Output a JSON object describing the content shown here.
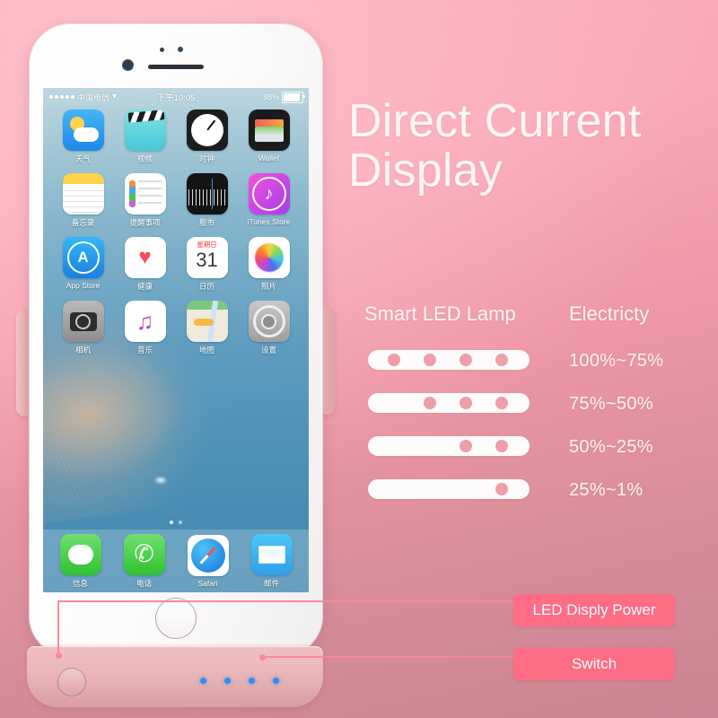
{
  "headline": {
    "line1": "Direct Current",
    "line2": "Display"
  },
  "columns": {
    "lamp": "Smart LED Lamp",
    "electricity": "Electricty"
  },
  "led_levels": [
    {
      "lit": 4,
      "range": "100%~75%"
    },
    {
      "lit": 3,
      "range": "75%~50%"
    },
    {
      "lit": 2,
      "range": "50%~25%"
    },
    {
      "lit": 1,
      "range": "25%~1%"
    }
  ],
  "callouts": {
    "led_power": "LED Disply Power",
    "switch": "Switch"
  },
  "colors": {
    "background_top": "#fcabb9",
    "background_bottom": "#c98591",
    "badge": "#ff6d85",
    "callout_line": "#f9879c",
    "pill": "#fdfbfb",
    "dot": "#ef9dab",
    "case_led": "#2f8cf5",
    "case_rose_gold": "#eab6b8"
  },
  "phone": {
    "statusbar": {
      "carrier": "中国电信",
      "wifi_icon": "wifi-icon",
      "time": "下午10:05",
      "battery_percent": "88%"
    },
    "apps": [
      {
        "label": "天气",
        "icon": "weather-icon"
      },
      {
        "label": "视频",
        "icon": "videos-icon"
      },
      {
        "label": "时钟",
        "icon": "clock-icon"
      },
      {
        "label": "Wallet",
        "icon": "wallet-icon"
      },
      {
        "label": "备忘录",
        "icon": "notes-icon"
      },
      {
        "label": "提醒事项",
        "icon": "reminders-icon"
      },
      {
        "label": "股市",
        "icon": "stocks-icon"
      },
      {
        "label": "iTunes Store",
        "icon": "itunes-store-icon"
      },
      {
        "label": "App Store",
        "icon": "app-store-icon"
      },
      {
        "label": "健康",
        "icon": "health-icon"
      },
      {
        "label": "日历",
        "icon": "calendar-icon"
      },
      {
        "label": "照片",
        "icon": "photos-icon"
      },
      {
        "label": "相机",
        "icon": "camera-icon"
      },
      {
        "label": "音乐",
        "icon": "music-icon"
      },
      {
        "label": "地图",
        "icon": "maps-icon"
      },
      {
        "label": "设置",
        "icon": "settings-icon"
      }
    ],
    "dock": [
      {
        "label": "信息",
        "icon": "messages-icon"
      },
      {
        "label": "电话",
        "icon": "phone-icon"
      },
      {
        "label": "Safari",
        "icon": "safari-icon"
      },
      {
        "label": "邮件",
        "icon": "mail-icon"
      }
    ],
    "calendar_icon": {
      "weekday": "星期日",
      "day": "31"
    }
  },
  "case": {
    "led_count": 4
  }
}
